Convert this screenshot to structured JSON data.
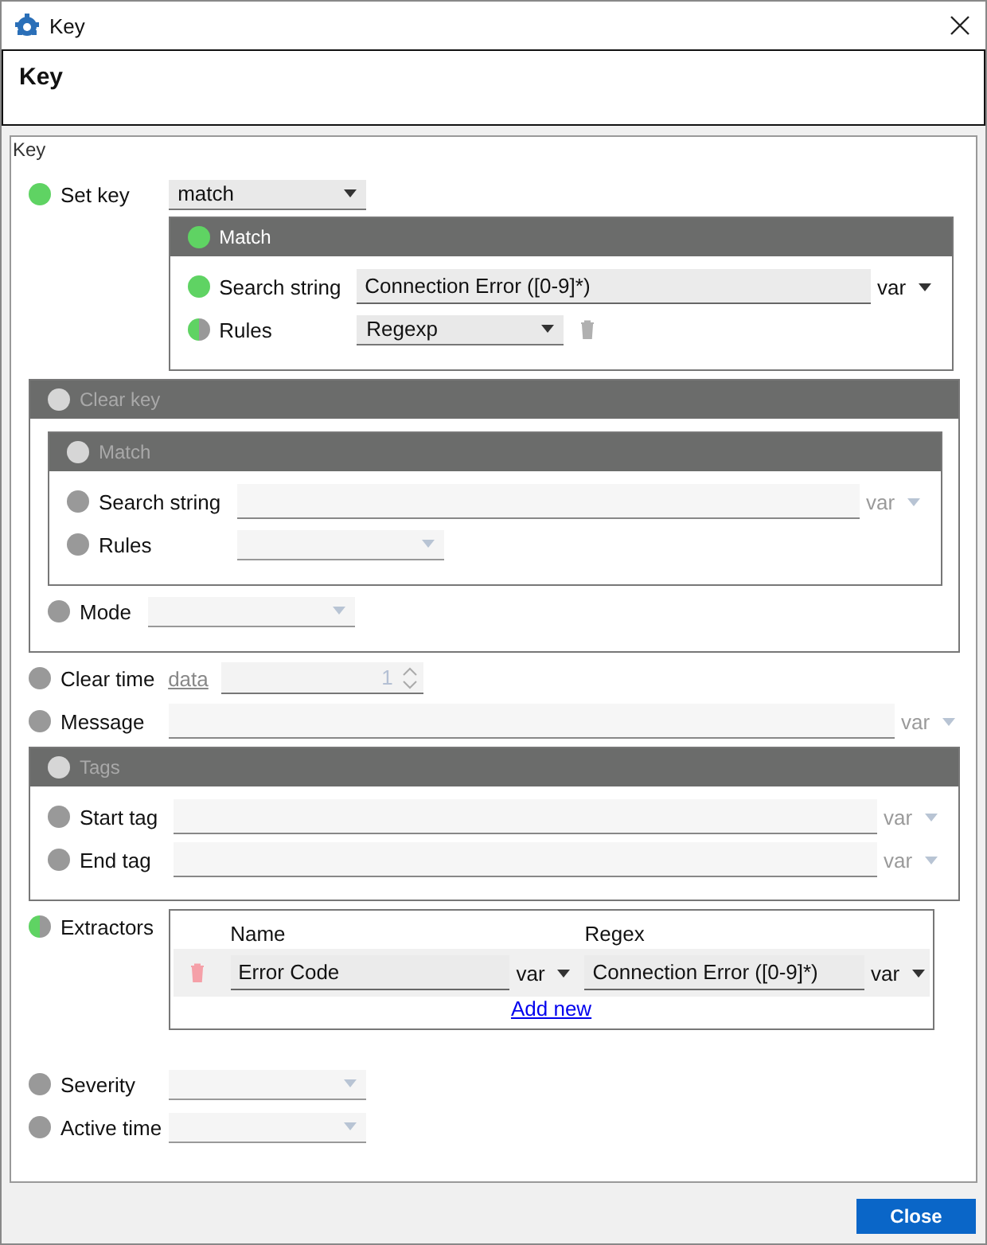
{
  "window": {
    "title": "Key"
  },
  "header": {
    "title": "Key"
  },
  "panel": {
    "legend": "Key",
    "rows": [
      {
        "kind": "select",
        "label": "Set key",
        "enabled": true,
        "partial": false,
        "value": "match",
        "disabled": false,
        "group": {
          "title": "Match",
          "disabled": false,
          "rows": [
            {
              "kind": "text",
              "label": "Search string",
              "enabled": true,
              "partial": false,
              "value": "Connection Error ([0-9]*)",
              "var": "var",
              "disabled": false
            },
            {
              "kind": "select",
              "label": "Rules",
              "enabled": true,
              "partial": true,
              "value": "Regexp",
              "disabled": false,
              "deletable": true
            }
          ]
        }
      },
      {
        "kind": "group",
        "title": "Clear key",
        "disabled": true,
        "rows": [
          {
            "kind": "group",
            "title": "Match",
            "disabled": true,
            "rows": [
              {
                "kind": "text",
                "label": "Search string",
                "enabled": false,
                "partial": false,
                "var": "var",
                "disabled": true
              },
              {
                "kind": "select",
                "label": "Rules",
                "enabled": false,
                "partial": false,
                "disabled": true
              }
            ]
          },
          {
            "kind": "select",
            "label": "Mode",
            "enabled": false,
            "partial": false,
            "disabled": true
          }
        ]
      },
      {
        "kind": "number",
        "label": "Clear time",
        "enabled": false,
        "partial": false,
        "link": "data",
        "value": "1",
        "disabled": true
      },
      {
        "kind": "text",
        "label": "Message",
        "enabled": false,
        "partial": false,
        "var": "var",
        "disabled": true
      },
      {
        "kind": "group",
        "title": "Tags",
        "disabled": true,
        "rows": [
          {
            "kind": "text",
            "label": "Start tag",
            "enabled": false,
            "partial": false,
            "var": "var",
            "disabled": true
          },
          {
            "kind": "text",
            "label": "End tag",
            "enabled": false,
            "partial": false,
            "var": "var",
            "disabled": true
          }
        ]
      },
      {
        "kind": "table",
        "label": "Extractors",
        "enabled": true,
        "partial": true,
        "columns": [
          "Name",
          "Regex"
        ],
        "rows": [
          {
            "name": "Error Code",
            "name_var": "var",
            "regex": "Connection Error ([0-9]*)",
            "regex_var": "var"
          }
        ],
        "add_link": "Add new"
      },
      {
        "kind": "select",
        "label": "Severity",
        "enabled": false,
        "partial": false,
        "disabled": true
      },
      {
        "kind": "select",
        "label": "Active time",
        "enabled": false,
        "partial": false,
        "disabled": true
      }
    ]
  },
  "footer": {
    "buttons": [
      "Close"
    ]
  }
}
